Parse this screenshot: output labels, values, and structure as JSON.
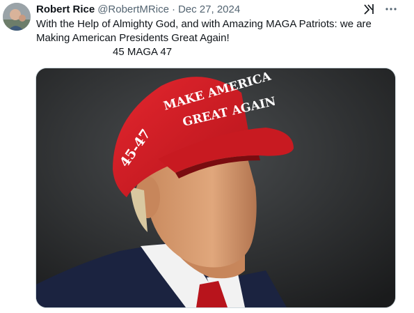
{
  "author": {
    "display_name": "Robert Rice",
    "handle": "@RobertMRice",
    "separator": "·",
    "date": "Dec 27, 2024"
  },
  "tweet": {
    "line1": "With the Help of Almighty God, and with Amazing MAGA Patriots: we are",
    "line2": "Making American Presidents Great Again!",
    "line3": "45 MAGA 47"
  },
  "media": {
    "hat_front_line1": "MAKE AMERICA",
    "hat_front_line2": "GREAT AGAIN",
    "hat_side": "45-47"
  },
  "icons": {
    "grok": "grok-icon",
    "more": "more-icon"
  },
  "colors": {
    "text": "#0f1419",
    "muted": "#536471",
    "hat_red": "#d81e25"
  }
}
